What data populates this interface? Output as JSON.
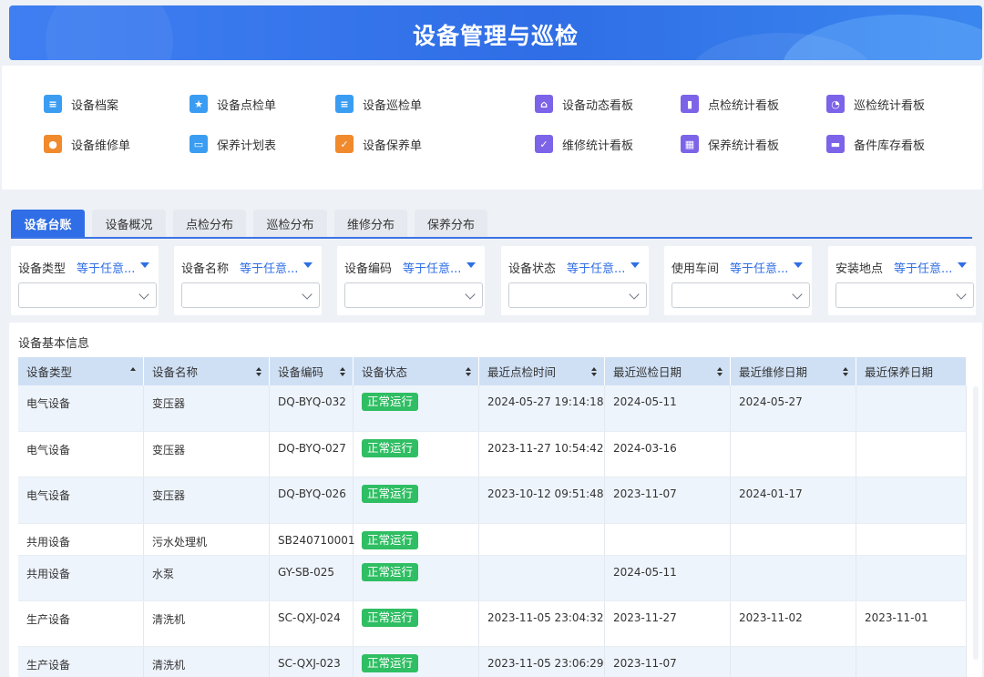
{
  "header": {
    "title": "设备管理与巡检"
  },
  "menu": {
    "items": [
      {
        "label": "设备档案",
        "icon": "file-icon",
        "color": "#3b9df2",
        "glyph": "≡"
      },
      {
        "label": "设备点检单",
        "icon": "badge-star-icon",
        "color": "#3b9df2",
        "glyph": "★"
      },
      {
        "label": "设备巡检单",
        "icon": "clipboard-icon",
        "color": "#3b9df2",
        "glyph": "≡"
      },
      {
        "label": "设备动态看板",
        "icon": "home-icon",
        "color": "#7d63e8",
        "glyph": "⌂"
      },
      {
        "label": "点检统计看板",
        "icon": "bar-chart-icon",
        "color": "#7d63e8",
        "glyph": "▮"
      },
      {
        "label": "巡检统计看板",
        "icon": "pie-chart-icon",
        "color": "#7d63e8",
        "glyph": "◔"
      },
      {
        "label": "设备维修单",
        "icon": "user-icon",
        "color": "#f08a2c",
        "glyph": "●"
      },
      {
        "label": "保养计划表",
        "icon": "wallet-icon",
        "color": "#3b9df2",
        "glyph": "▭"
      },
      {
        "label": "设备保养单",
        "icon": "shield-check-icon",
        "color": "#f08a2c",
        "glyph": "✓"
      },
      {
        "label": "维修统计看板",
        "icon": "shield-check-icon",
        "color": "#7d63e8",
        "glyph": "✓"
      },
      {
        "label": "保养统计看板",
        "icon": "calendar-icon",
        "color": "#7d63e8",
        "glyph": "▦"
      },
      {
        "label": "备件库存看板",
        "icon": "inbox-icon",
        "color": "#7d63e8",
        "glyph": "▬"
      }
    ]
  },
  "tabs": [
    "设备台账",
    "设备概况",
    "点检分布",
    "巡检分布",
    "维修分布",
    "保养分布"
  ],
  "active_tab": "设备台账",
  "filters": [
    {
      "label": "设备类型",
      "op": "等于任意..."
    },
    {
      "label": "设备名称",
      "op": "等于任意..."
    },
    {
      "label": "设备编码",
      "op": "等于任意..."
    },
    {
      "label": "设备状态",
      "op": "等于任意..."
    },
    {
      "label": "使用车间",
      "op": "等于任意..."
    },
    {
      "label": "安装地点",
      "op": "等于任意..."
    }
  ],
  "table": {
    "title": "设备基本信息",
    "columns": [
      "设备类型",
      "设备名称",
      "设备编码",
      "设备状态",
      "最近点检时间",
      "最近巡检日期",
      "最近维修日期",
      "最近保养日期"
    ],
    "rows": [
      [
        "电气设备",
        "变压器",
        "DQ-BYQ-032",
        "正常运行",
        "2024-05-27 19:14:18",
        "2024-05-11",
        "2024-05-27",
        ""
      ],
      [
        "电气设备",
        "变压器",
        "DQ-BYQ-027",
        "正常运行",
        "2023-11-27 10:54:42",
        "2024-03-16",
        "",
        ""
      ],
      [
        "电气设备",
        "变压器",
        "DQ-BYQ-026",
        "正常运行",
        "2023-10-12 09:51:48",
        "2023-11-07",
        "2024-01-17",
        ""
      ],
      [
        "共用设备",
        "污水处理机",
        "SB240710001",
        "正常运行",
        "",
        "",
        "",
        ""
      ],
      [
        "共用设备",
        "水泵",
        "GY-SB-025",
        "正常运行",
        "",
        "2024-05-11",
        "",
        ""
      ],
      [
        "生产设备",
        "清洗机",
        "SC-QXJ-024",
        "正常运行",
        "2023-11-05 23:04:32",
        "2023-11-27",
        "2023-11-02",
        "2023-11-01"
      ],
      [
        "生产设备",
        "清洗机",
        "SC-QXJ-023",
        "正常运行",
        "2023-11-05 23:06:29",
        "2023-11-07",
        "",
        ""
      ]
    ],
    "status_color": "#2fbe63"
  }
}
